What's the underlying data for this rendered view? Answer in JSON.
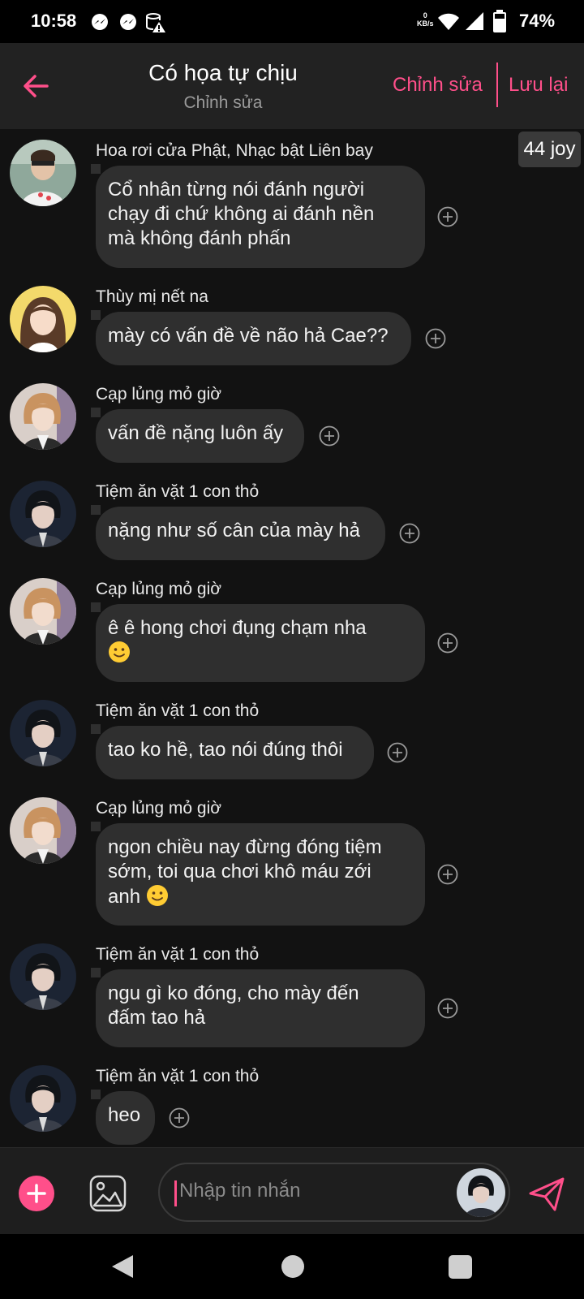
{
  "status_bar": {
    "time": "10:58",
    "net_speed_value": "0",
    "net_speed_unit": "KB/s",
    "battery": "74%",
    "icons": [
      "messenger-icon",
      "messenger-icon",
      "storage-alert-icon",
      "wifi-icon",
      "signal-icon",
      "battery-icon"
    ]
  },
  "header": {
    "title": "Có họa tự chịu",
    "subtitle": "Chỉnh sửa",
    "edit_label": "Chỉnh sửa",
    "save_label": "Lưu lại",
    "accent_color": "#ff4f8a"
  },
  "chat": {
    "joy_badge": "44 joy",
    "messages": [
      {
        "sender": "Hoa rơi cửa Phật, Nhạc bật Liên bay",
        "lines": [
          "Cổ nhân từng nói đánh người",
          "chạy đi chứ không ai đánh nền",
          "mà không đánh phấn"
        ]
      },
      {
        "sender": "Thùy mị nết na",
        "lines": [
          "mày có vấn đề về não hả Cae??"
        ]
      },
      {
        "sender": "Cạp lủng mỏ giờ",
        "lines": [
          "vấn đề nặng luôn ấy"
        ]
      },
      {
        "sender": "Tiệm ăn vặt 1 con thỏ",
        "lines": [
          "nặng như số cân của mày hả"
        ]
      },
      {
        "sender": "Cạp lủng mỏ giờ",
        "lines": [
          "ê ê hong chơi đụng chạm nha"
        ],
        "emoji": "slightly-smiling-face"
      },
      {
        "sender": "Tiệm ăn vặt 1 con thỏ",
        "lines": [
          "tao ko hề, tao nói đúng thôi"
        ]
      },
      {
        "sender": "Cạp lủng mỏ giờ",
        "lines": [
          "ngon chiều nay đừng đóng tiệm",
          "sớm, toi qua chơi khô máu zới",
          "anh"
        ],
        "emoji": "slightly-smiling-face"
      },
      {
        "sender": "Tiệm ăn vặt 1 con thỏ",
        "lines": [
          "ngu gì ko đóng, cho mày đến",
          "đấm tao hả"
        ]
      },
      {
        "sender": "Tiệm ăn vặt 1 con thỏ",
        "lines": [
          "heo"
        ]
      }
    ]
  },
  "input": {
    "placeholder": "Nhập tin nhắn",
    "value": ""
  }
}
